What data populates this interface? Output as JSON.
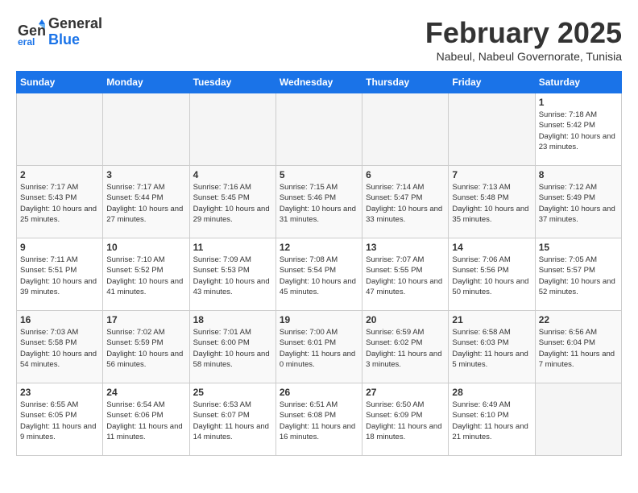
{
  "header": {
    "logo_line1": "General",
    "logo_line2": "Blue",
    "month_title": "February 2025",
    "subtitle": "Nabeul, Nabeul Governorate, Tunisia"
  },
  "weekdays": [
    "Sunday",
    "Monday",
    "Tuesday",
    "Wednesday",
    "Thursday",
    "Friday",
    "Saturday"
  ],
  "weeks": [
    [
      {
        "day": "",
        "empty": true
      },
      {
        "day": "",
        "empty": true
      },
      {
        "day": "",
        "empty": true
      },
      {
        "day": "",
        "empty": true
      },
      {
        "day": "",
        "empty": true
      },
      {
        "day": "",
        "empty": true
      },
      {
        "day": "1",
        "sunrise": "7:18 AM",
        "sunset": "5:42 PM",
        "daylight": "10 hours and 23 minutes."
      }
    ],
    [
      {
        "day": "2",
        "sunrise": "7:17 AM",
        "sunset": "5:43 PM",
        "daylight": "10 hours and 25 minutes."
      },
      {
        "day": "3",
        "sunrise": "7:17 AM",
        "sunset": "5:44 PM",
        "daylight": "10 hours and 27 minutes."
      },
      {
        "day": "4",
        "sunrise": "7:16 AM",
        "sunset": "5:45 PM",
        "daylight": "10 hours and 29 minutes."
      },
      {
        "day": "5",
        "sunrise": "7:15 AM",
        "sunset": "5:46 PM",
        "daylight": "10 hours and 31 minutes."
      },
      {
        "day": "6",
        "sunrise": "7:14 AM",
        "sunset": "5:47 PM",
        "daylight": "10 hours and 33 minutes."
      },
      {
        "day": "7",
        "sunrise": "7:13 AM",
        "sunset": "5:48 PM",
        "daylight": "10 hours and 35 minutes."
      },
      {
        "day": "8",
        "sunrise": "7:12 AM",
        "sunset": "5:49 PM",
        "daylight": "10 hours and 37 minutes."
      }
    ],
    [
      {
        "day": "9",
        "sunrise": "7:11 AM",
        "sunset": "5:51 PM",
        "daylight": "10 hours and 39 minutes."
      },
      {
        "day": "10",
        "sunrise": "7:10 AM",
        "sunset": "5:52 PM",
        "daylight": "10 hours and 41 minutes."
      },
      {
        "day": "11",
        "sunrise": "7:09 AM",
        "sunset": "5:53 PM",
        "daylight": "10 hours and 43 minutes."
      },
      {
        "day": "12",
        "sunrise": "7:08 AM",
        "sunset": "5:54 PM",
        "daylight": "10 hours and 45 minutes."
      },
      {
        "day": "13",
        "sunrise": "7:07 AM",
        "sunset": "5:55 PM",
        "daylight": "10 hours and 47 minutes."
      },
      {
        "day": "14",
        "sunrise": "7:06 AM",
        "sunset": "5:56 PM",
        "daylight": "10 hours and 50 minutes."
      },
      {
        "day": "15",
        "sunrise": "7:05 AM",
        "sunset": "5:57 PM",
        "daylight": "10 hours and 52 minutes."
      }
    ],
    [
      {
        "day": "16",
        "sunrise": "7:03 AM",
        "sunset": "5:58 PM",
        "daylight": "10 hours and 54 minutes."
      },
      {
        "day": "17",
        "sunrise": "7:02 AM",
        "sunset": "5:59 PM",
        "daylight": "10 hours and 56 minutes."
      },
      {
        "day": "18",
        "sunrise": "7:01 AM",
        "sunset": "6:00 PM",
        "daylight": "10 hours and 58 minutes."
      },
      {
        "day": "19",
        "sunrise": "7:00 AM",
        "sunset": "6:01 PM",
        "daylight": "11 hours and 0 minutes."
      },
      {
        "day": "20",
        "sunrise": "6:59 AM",
        "sunset": "6:02 PM",
        "daylight": "11 hours and 3 minutes."
      },
      {
        "day": "21",
        "sunrise": "6:58 AM",
        "sunset": "6:03 PM",
        "daylight": "11 hours and 5 minutes."
      },
      {
        "day": "22",
        "sunrise": "6:56 AM",
        "sunset": "6:04 PM",
        "daylight": "11 hours and 7 minutes."
      }
    ],
    [
      {
        "day": "23",
        "sunrise": "6:55 AM",
        "sunset": "6:05 PM",
        "daylight": "11 hours and 9 minutes."
      },
      {
        "day": "24",
        "sunrise": "6:54 AM",
        "sunset": "6:06 PM",
        "daylight": "11 hours and 11 minutes."
      },
      {
        "day": "25",
        "sunrise": "6:53 AM",
        "sunset": "6:07 PM",
        "daylight": "11 hours and 14 minutes."
      },
      {
        "day": "26",
        "sunrise": "6:51 AM",
        "sunset": "6:08 PM",
        "daylight": "11 hours and 16 minutes."
      },
      {
        "day": "27",
        "sunrise": "6:50 AM",
        "sunset": "6:09 PM",
        "daylight": "11 hours and 18 minutes."
      },
      {
        "day": "28",
        "sunrise": "6:49 AM",
        "sunset": "6:10 PM",
        "daylight": "11 hours and 21 minutes."
      },
      {
        "day": "",
        "empty": true
      }
    ]
  ]
}
